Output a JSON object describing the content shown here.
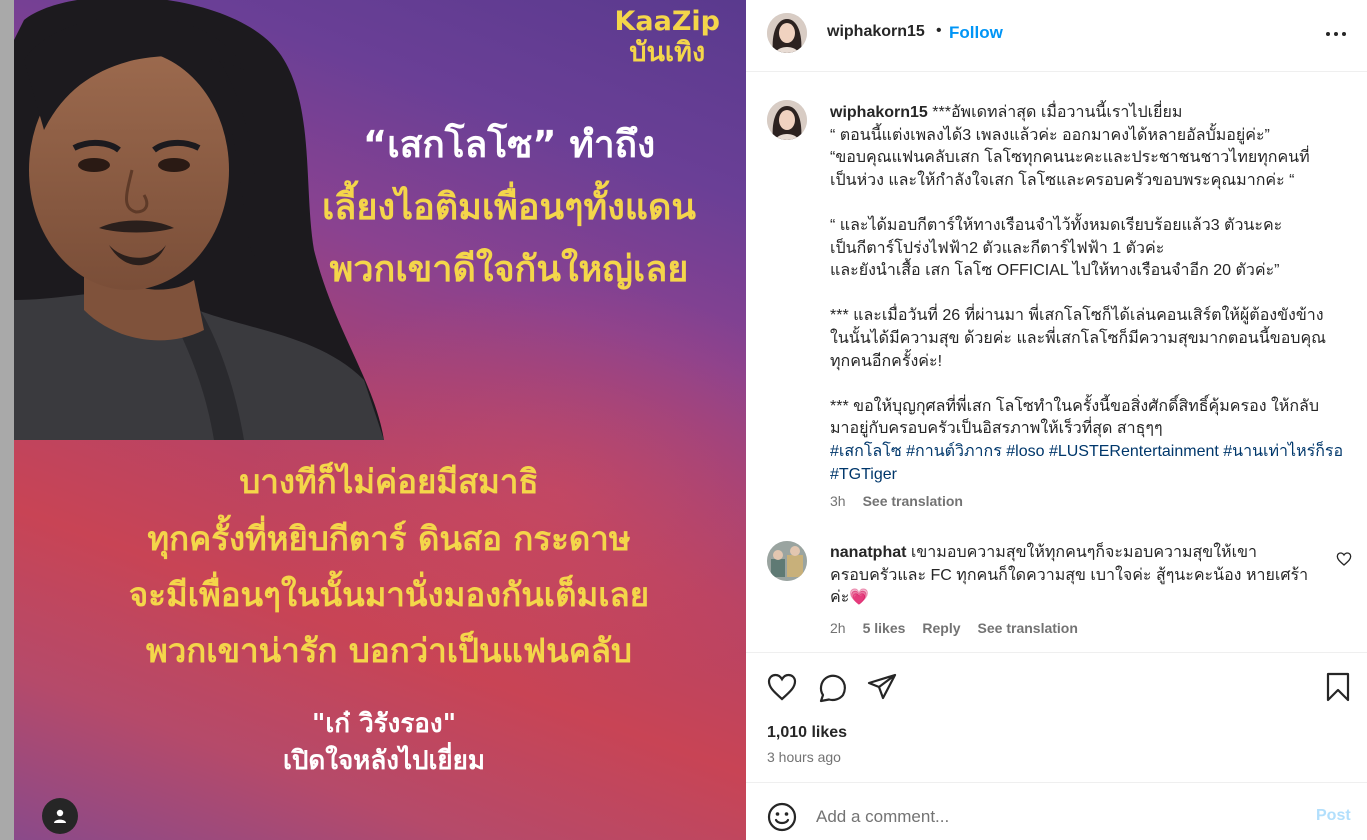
{
  "media": {
    "brand_line1": "KaaZip",
    "brand_line2": "บันเทิง",
    "headline_white": "“เสกโลโซ” ทำถึง",
    "headline_yellow1": "เลี้ยงไอติมเพื่อนๆทั้งแดน",
    "headline_yellow2": "พวกเขาดีใจกันใหญ่เลย",
    "quote_lines": [
      "บางทีก็ไม่ค่อยมีสมาธิ",
      "ทุกครั้งที่หยิบกีตาร์ ดินสอ กระดาษ",
      "จะมีเพื่อนๆในนั้นมานั่งมองกันเต็มเลย",
      "พวกเขาน่ารัก บอกว่าเป็นแฟนคลับ"
    ],
    "credit_line1": "\"เก๋ วิรังรอง\"",
    "credit_line2": "เปิดใจหลังไปเยี่ยม",
    "colors": {
      "yellow": "#f4d64a",
      "white": "#ffffff"
    }
  },
  "header": {
    "username": "wiphakorn15",
    "separator": "•",
    "follow_label": "Follow",
    "more_icon": "more-horizontal-icon"
  },
  "caption": {
    "username": "wiphakorn15",
    "text": " ***อัพเดทล่าสุด เมื่อวานนี้เราไปเยี่ยม\n“ ตอนนี้แต่งเพลงได้3 เพลงแล้วค่ะ ออกมาคงได้หลายอัลบั้มอยู่ค่ะ”\n“ขอบคุณแฟนคลับเสก โลโซทุกคนนะคะและประชาชนชาวไทยทุกคนที่\nเป็นห่วง และให้กำลังใจเสก โลโซและครอบครัวขอบพระคุณมากค่ะ “\n\n“ และได้มอบกีตาร์ให้ทางเรือนจำไว้ทั้งหมดเรียบร้อยแล้ว3 ตัวนะคะ\nเป็นกีตาร์โปร่งไฟฟ้า2 ตัวและกีตาร์ไฟฟ้า 1 ตัวค่ะ\nและยังนำเสื้อ เสก โลโซ OFFICIAL ไปให้ทางเรือนจำอีก 20 ตัวค่ะ”\n\n*** และเมื่อวันที่ 26 ที่ผ่านมา พี่เสกโลโซก็ได้เล่นคอนเสิร์ตให้ผู้ต้องขังข้าง\nในนั้นได้มีความสุข ด้วยค่ะ และพี่เสกโลโซก็มีความสุขมากตอนนี้ขอบคุณ\nทุกคนอีกครั้งค่ะ!\n\n*** ขอให้บุญกุศลที่พี่เสก โลโซทำในครั้งนี้ขอสิ่งศักดิ์สิทธิ์คุ้มครอง ให้กลับ\nมาอยู่กับครอบครัวเป็นอิสรภาพให้เร็วที่สุด สาธุๆๆ",
    "hashtags": "#เสกโลโซ #กานต์วิภากร #loso #LUSTERentertainment #นานเท่าไหร่ก็รอ #TGTiger",
    "time": "3h",
    "see_translation": "See translation"
  },
  "comment": {
    "username": "nanatphat",
    "text": " เขามอบความสุขให้ทุกคนๆก็จะมอบความสุขให้เขา ครอบครัวและ FC ทุกคนก็ใดความสุข เบาใจค่ะ สู้ๆนะคะน้อง หายเศร้าค่ะ💗",
    "time": "2h",
    "likes": "5 likes",
    "reply": "Reply",
    "see_translation": "See translation"
  },
  "actions": {
    "likes_count": "1,010 likes",
    "time_ago": "3 hours ago"
  },
  "add_comment": {
    "placeholder": "Add a comment...",
    "post_label": "Post"
  }
}
